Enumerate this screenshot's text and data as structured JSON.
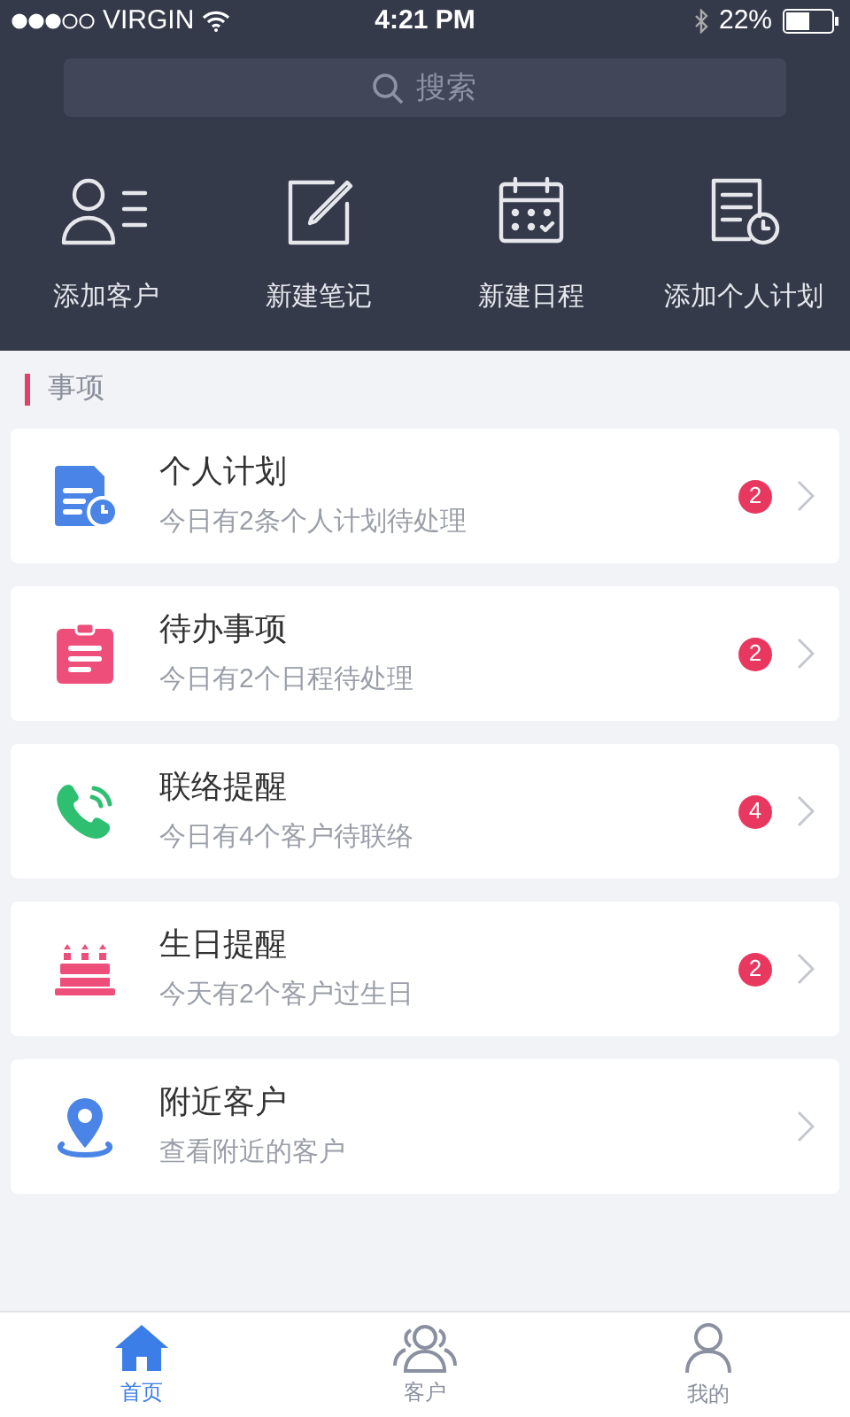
{
  "status_bar": {
    "carrier": "VIRGIN",
    "time": "4:21 PM",
    "battery": "22%"
  },
  "search": {
    "placeholder": "搜索"
  },
  "quick_actions": [
    {
      "kind": "customer",
      "label": "添加客户"
    },
    {
      "kind": "note",
      "label": "新建笔记"
    },
    {
      "kind": "calendar",
      "label": "新建日程"
    },
    {
      "kind": "plan",
      "label": "添加个人计划"
    }
  ],
  "section": {
    "title": "事项"
  },
  "items": [
    {
      "kind": "plan",
      "title": "个人计划",
      "subtitle": "今日有2条个人计划待处理",
      "badge": "2"
    },
    {
      "kind": "todo",
      "title": "待办事项",
      "subtitle": "今日有2个日程待处理",
      "badge": "2"
    },
    {
      "kind": "phone",
      "title": "联络提醒",
      "subtitle": "今日有4个客户待联络",
      "badge": "4"
    },
    {
      "kind": "cake",
      "title": "生日提醒",
      "subtitle": "今天有2个客户过生日",
      "badge": "2"
    },
    {
      "kind": "location",
      "title": "附近客户",
      "subtitle": "查看附近的客户"
    }
  ],
  "tab_bar": [
    {
      "kind": "home",
      "label": "首页",
      "selected": true
    },
    {
      "kind": "customers",
      "label": "客户",
      "selected": false
    },
    {
      "kind": "me",
      "label": "我的",
      "selected": false
    }
  ]
}
